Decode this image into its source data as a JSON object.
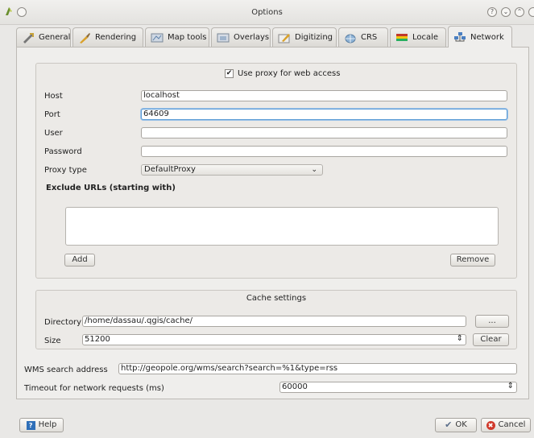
{
  "window": {
    "title": "Options",
    "buttons": [
      "?",
      "⌄",
      "⌃"
    ]
  },
  "tabs": [
    "General",
    "Rendering",
    "Map tools",
    "Overlays",
    "Digitizing",
    "CRS",
    "Locale",
    "Network"
  ],
  "proxy": {
    "use_proxy_label": "Use proxy for web access",
    "checked_mark": "✔",
    "host_label": "Host",
    "host_value": "localhost",
    "port_label": "Port",
    "port_value": "64609",
    "user_label": "User",
    "user_value": "",
    "password_label": "Password",
    "password_value": "",
    "proxy_type_label": "Proxy type",
    "proxy_type_value": "DefaultProxy",
    "exclude_label": "Exclude URLs (starting with)",
    "add_label": "Add",
    "remove_label": "Remove"
  },
  "cache": {
    "title": "Cache settings",
    "directory_label": "Directory",
    "directory_value": "/home/dassau/.qgis/cache/",
    "browse_label": "...",
    "size_label": "Size",
    "size_value": "51200",
    "clear_label": "Clear"
  },
  "wms": {
    "label": "WMS search address",
    "value": "http://geopole.org/wms/search?search=%1&type=rss"
  },
  "timeout": {
    "label": "Timeout for network requests (ms)",
    "value": "60000"
  },
  "footer": {
    "help_label": "Help",
    "ok_label": "OK",
    "cancel_label": "Cancel"
  },
  "colors": {
    "focus": "#5b9bd5",
    "cancel_icon": "#d0392b",
    "ok_icon": "#5b6e8a"
  }
}
